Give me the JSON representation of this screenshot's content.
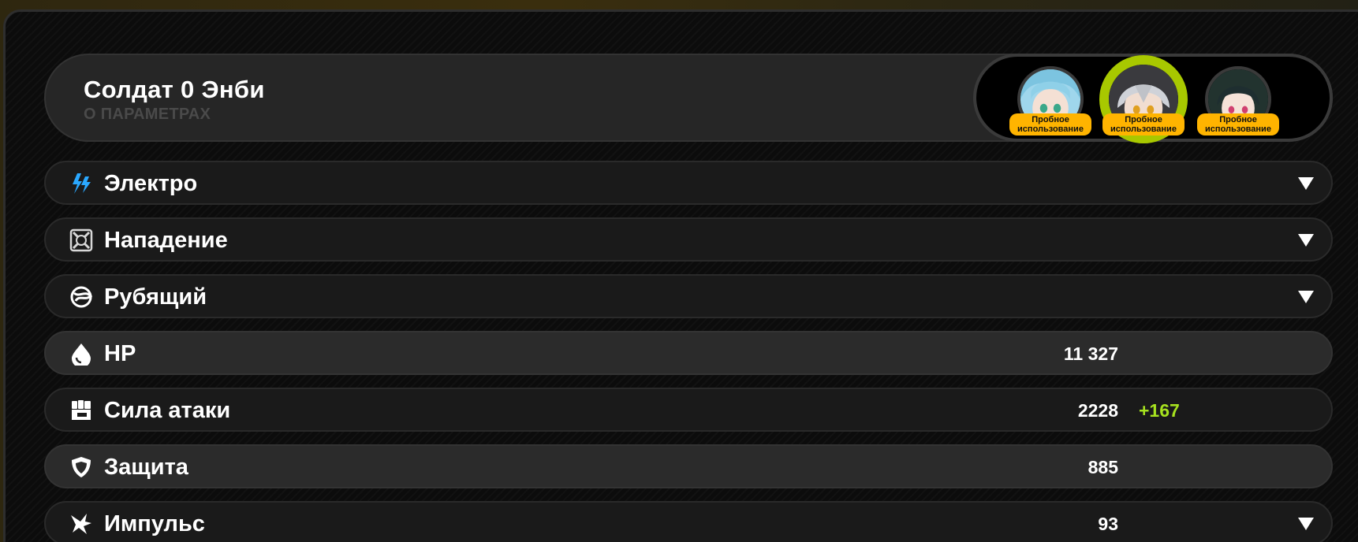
{
  "header": {
    "title": "Солдат 0 Энби",
    "subtitle": "О ПАРАМЕТРАХ"
  },
  "agents": [
    {
      "badge": "Пробное использование",
      "selected": false,
      "hair": "#8fd0e8",
      "eyes": "#3aa88a"
    },
    {
      "badge": "Пробное использование",
      "selected": true,
      "hair": "#cfd2d8",
      "eyes": "#e0a020"
    },
    {
      "badge": "Пробное использование",
      "selected": false,
      "hair": "#1e2e30",
      "eyes": "#d04070"
    }
  ],
  "rows": [
    {
      "icon": "electric-icon",
      "label": "Электро",
      "value": "",
      "bonus": "",
      "expandable": true
    },
    {
      "icon": "attack-type-icon",
      "label": "Нападение",
      "value": "",
      "bonus": "",
      "expandable": true
    },
    {
      "icon": "slash-icon",
      "label": "Рубящий",
      "value": "",
      "bonus": "",
      "expandable": true
    },
    {
      "icon": "hp-drop-icon",
      "label": "HP",
      "value": "11 327",
      "bonus": "",
      "expandable": false
    },
    {
      "icon": "fist-icon",
      "label": "Сила атаки",
      "value": "2228",
      "bonus": "+167",
      "expandable": false
    },
    {
      "icon": "shield-icon",
      "label": "Защита",
      "value": "885",
      "bonus": "",
      "expandable": false
    },
    {
      "icon": "impulse-icon",
      "label": "Импульс",
      "value": "93",
      "bonus": "",
      "expandable": true
    }
  ],
  "colors": {
    "accent_selected": "#a8c800",
    "badge": "#ffb400",
    "bonus": "#a6e21f",
    "electric": "#2aa8ff"
  }
}
